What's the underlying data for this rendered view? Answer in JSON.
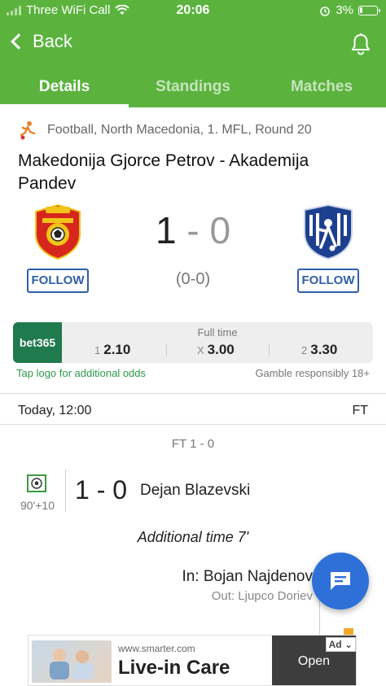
{
  "status": {
    "carrier": "Three WiFi Call",
    "time": "20:06",
    "battery": "3%"
  },
  "nav": {
    "back_label": "Back"
  },
  "tabs": [
    {
      "label": "Details",
      "active": true
    },
    {
      "label": "Standings",
      "active": false
    },
    {
      "label": "Matches",
      "active": false
    }
  ],
  "match": {
    "meta": "Football, North Macedonia, 1. MFL, Round 20",
    "title": "Makedonija Gjorce Petrov - Akademija Pandev",
    "home": {
      "follow_label": "FOLLOW"
    },
    "away": {
      "follow_label": "FOLLOW"
    },
    "score_home": "1",
    "score_sep": " - ",
    "score_away": "0",
    "halftime": "(0-0)"
  },
  "odds": {
    "brand": "bet365",
    "label": "Full time",
    "options": [
      {
        "key": "1",
        "value": "2.10"
      },
      {
        "key": "X",
        "value": "3.00"
      },
      {
        "key": "2",
        "value": "3.30"
      }
    ],
    "note_left": "Tap logo for additional odds",
    "note_right": "Gamble responsibly 18+"
  },
  "events": {
    "date": "Today, 12:00",
    "status": "FT",
    "ft_score": "FT 1 - 0",
    "goal": {
      "minute": "90'+10",
      "score": "1 - 0",
      "player": "Dejan Blazevski"
    },
    "added_time": "Additional time 7'",
    "substitution": {
      "in": "In: Bojan Najdenov",
      "out": "Out: Ljupco Doriev"
    }
  },
  "ad": {
    "url": "www.smarter.com",
    "title": "Live-in Care",
    "cta": "Open",
    "badge": "Ad"
  },
  "colors": {
    "header": "#5bb33e",
    "follow": "#2f5fa7",
    "fab": "#2f6fd8",
    "bet365": "#1f7a4d"
  }
}
